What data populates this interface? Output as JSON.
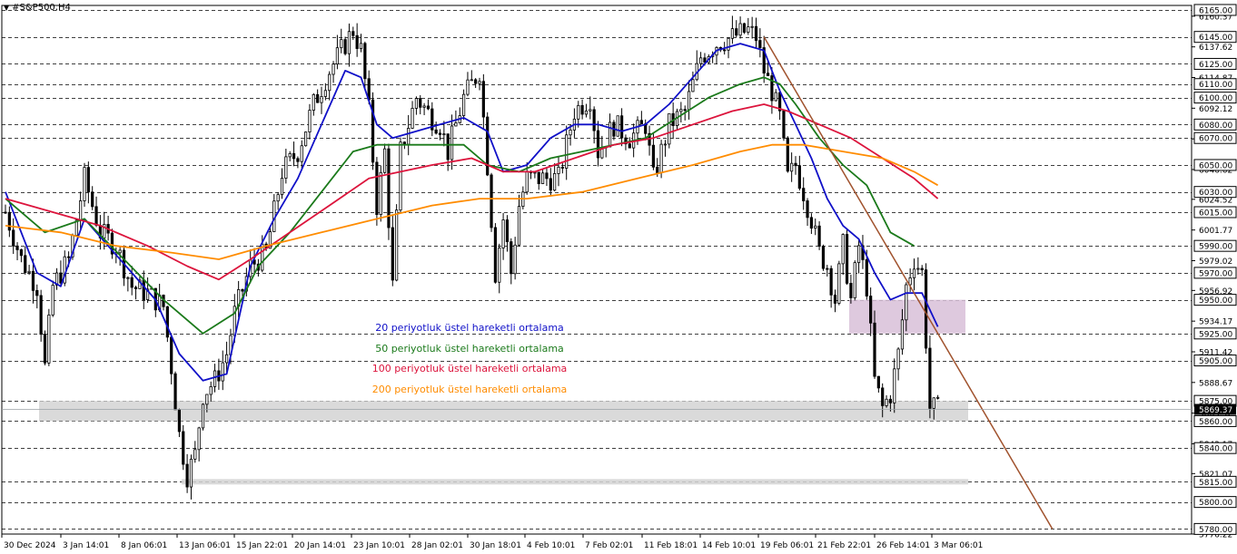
{
  "window": {
    "title": "#S&P500,H4",
    "menu_icon": "triangle-down-icon"
  },
  "chart_data": {
    "type": "candlestick",
    "symbol": "#S&P500",
    "timeframe": "H4",
    "ylim": [
      5776.22,
      6167
    ],
    "grid": "horizontal dashed at key levels",
    "x_ticks": [
      "30 Dec 2024",
      "3 Jan 14:01",
      "8 Jan 06:01",
      "13 Jan 06:01",
      "15 Jan 22:01",
      "20 Jan 14:01",
      "23 Jan 10:01",
      "28 Jan 02:01",
      "30 Jan 18:01",
      "4 Feb 10:01",
      "7 Feb 02:01",
      "11 Feb 18:01",
      "14 Feb 10:01",
      "19 Feb 06:01",
      "21 Feb 22:01",
      "26 Feb 14:01",
      "3 Mar 06:01"
    ],
    "y_ticks": [
      6160.37,
      6137.62,
      6114.87,
      6092.12,
      6069.37,
      6046.62,
      6024.52,
      6001.77,
      5979.02,
      5956.92,
      5934.17,
      5911.42,
      5888.67,
      5865.92,
      5843.17,
      5821.07,
      5776.22
    ],
    "boxed_levels": [
      6165.0,
      6145.0,
      6125.0,
      6110.0,
      6100.0,
      6080.0,
      6070.0,
      6050.0,
      6030.0,
      6015.0,
      5990.0,
      5970.0,
      5950.0,
      5925.0,
      5905.0,
      5875.0,
      5860.0,
      5840.0,
      5815.0,
      5800.0,
      5780.0
    ],
    "current_price": 5869.37,
    "zones": [
      {
        "name": "support-zone",
        "y1": 5860,
        "y2": 5875,
        "color": "#d3d3d3"
      },
      {
        "name": "support-line-zone",
        "y1": 5813,
        "y2": 5817,
        "color": "#d3d3d3"
      },
      {
        "name": "resistance-zone",
        "y1": 5925,
        "y2": 5950,
        "color": "#d8bfd8"
      }
    ],
    "trendline": {
      "color": "#a0522d",
      "from": {
        "bar": 192,
        "y": 6145
      },
      "to": {
        "bar": 265,
        "y": 5780
      }
    },
    "legend": [
      {
        "label": "20 periyotluk üstel hareketli ortalama",
        "color": "#1010c8"
      },
      {
        "label": "50 periyotluk üstel hareketli ortalama",
        "color": "#1b7a1b"
      },
      {
        "label": "100 periyotluk üstel hareketli ortalama",
        "color": "#dc143c"
      },
      {
        "label": "200 periyotluk üstel hareketli ortalama",
        "color": "#ff8c00"
      }
    ],
    "close_path": [
      [
        0,
        6015
      ],
      [
        4,
        5980
      ],
      [
        8,
        5960
      ],
      [
        10,
        5900
      ],
      [
        12,
        5960
      ],
      [
        16,
        5980
      ],
      [
        20,
        6040
      ],
      [
        24,
        6000
      ],
      [
        28,
        5990
      ],
      [
        32,
        5960
      ],
      [
        36,
        5955
      ],
      [
        40,
        5945
      ],
      [
        42,
        5900
      ],
      [
        44,
        5850
      ],
      [
        46,
        5820
      ],
      [
        48,
        5835
      ],
      [
        50,
        5880
      ],
      [
        53,
        5890
      ],
      [
        56,
        5910
      ],
      [
        58,
        5940
      ],
      [
        62,
        5975
      ],
      [
        66,
        5985
      ],
      [
        70,
        6045
      ],
      [
        74,
        6060
      ],
      [
        78,
        6095
      ],
      [
        82,
        6120
      ],
      [
        86,
        6140
      ],
      [
        88,
        6150
      ],
      [
        90,
        6135
      ],
      [
        92,
        6090
      ],
      [
        94,
        6020
      ],
      [
        96,
        6060
      ],
      [
        98,
        5960
      ],
      [
        100,
        6060
      ],
      [
        104,
        6100
      ],
      [
        108,
        6085
      ],
      [
        110,
        6080
      ],
      [
        112,
        6060
      ],
      [
        116,
        6100
      ],
      [
        120,
        6120
      ],
      [
        122,
        6050
      ],
      [
        124,
        5970
      ],
      [
        126,
        6010
      ],
      [
        128,
        5970
      ],
      [
        130,
        6020
      ],
      [
        132,
        6040
      ],
      [
        136,
        6040
      ],
      [
        140,
        6040
      ],
      [
        144,
        6090
      ],
      [
        148,
        6100
      ],
      [
        150,
        6060
      ],
      [
        154,
        6080
      ],
      [
        158,
        6070
      ],
      [
        162,
        6080
      ],
      [
        164,
        6040
      ],
      [
        168,
        6080
      ],
      [
        172,
        6090
      ],
      [
        176,
        6130
      ],
      [
        180,
        6140
      ],
      [
        184,
        6145
      ],
      [
        188,
        6150
      ],
      [
        190,
        6145
      ],
      [
        192,
        6120
      ],
      [
        194,
        6105
      ],
      [
        196,
        6085
      ],
      [
        198,
        6040
      ],
      [
        200,
        6050
      ],
      [
        202,
        6030
      ],
      [
        204,
        6010
      ],
      [
        206,
        5985
      ],
      [
        208,
        5975
      ],
      [
        210,
        5950
      ],
      [
        212,
        5990
      ],
      [
        214,
        5950
      ],
      [
        216,
        5990
      ],
      [
        218,
        5960
      ],
      [
        220,
        5890
      ],
      [
        222,
        5870
      ],
      [
        224,
        5880
      ],
      [
        226,
        5910
      ],
      [
        228,
        5960
      ],
      [
        230,
        5980
      ],
      [
        232,
        5970
      ],
      [
        234,
        5870
      ],
      [
        236,
        5869
      ]
    ],
    "ema_series": {
      "ema20": [
        [
          0,
          6030
        ],
        [
          8,
          5970
        ],
        [
          14,
          5960
        ],
        [
          20,
          6010
        ],
        [
          26,
          5990
        ],
        [
          32,
          5970
        ],
        [
          38,
          5950
        ],
        [
          44,
          5910
        ],
        [
          50,
          5890
        ],
        [
          56,
          5895
        ],
        [
          62,
          5975
        ],
        [
          68,
          6010
        ],
        [
          74,
          6040
        ],
        [
          80,
          6080
        ],
        [
          86,
          6120
        ],
        [
          90,
          6115
        ],
        [
          94,
          6080
        ],
        [
          98,
          6070
        ],
        [
          104,
          6075
        ],
        [
          110,
          6080
        ],
        [
          116,
          6085
        ],
        [
          122,
          6075
        ],
        [
          126,
          6045
        ],
        [
          132,
          6050
        ],
        [
          138,
          6070
        ],
        [
          144,
          6080
        ],
        [
          150,
          6080
        ],
        [
          156,
          6075
        ],
        [
          162,
          6080
        ],
        [
          168,
          6095
        ],
        [
          174,
          6115
        ],
        [
          180,
          6135
        ],
        [
          186,
          6140
        ],
        [
          192,
          6135
        ],
        [
          196,
          6105
        ],
        [
          200,
          6080
        ],
        [
          204,
          6055
        ],
        [
          208,
          6025
        ],
        [
          212,
          6005
        ],
        [
          216,
          5995
        ],
        [
          220,
          5970
        ],
        [
          224,
          5950
        ],
        [
          228,
          5955
        ],
        [
          232,
          5955
        ],
        [
          236,
          5930
        ]
      ],
      "ema50": [
        [
          0,
          6025
        ],
        [
          10,
          6000
        ],
        [
          20,
          6010
        ],
        [
          30,
          5980
        ],
        [
          40,
          5950
        ],
        [
          50,
          5925
        ],
        [
          58,
          5940
        ],
        [
          64,
          5975
        ],
        [
          72,
          6000
        ],
        [
          80,
          6030
        ],
        [
          88,
          6060
        ],
        [
          94,
          6065
        ],
        [
          100,
          6065
        ],
        [
          108,
          6065
        ],
        [
          116,
          6065
        ],
        [
          122,
          6050
        ],
        [
          130,
          6045
        ],
        [
          138,
          6055
        ],
        [
          146,
          6060
        ],
        [
          154,
          6065
        ],
        [
          162,
          6070
        ],
        [
          170,
          6085
        ],
        [
          178,
          6100
        ],
        [
          186,
          6110
        ],
        [
          192,
          6115
        ],
        [
          196,
          6110
        ],
        [
          200,
          6095
        ],
        [
          206,
          6070
        ],
        [
          212,
          6050
        ],
        [
          218,
          6035
        ],
        [
          224,
          6000
        ],
        [
          230,
          5990
        ]
      ],
      "ema100": [
        [
          0,
          6025
        ],
        [
          12,
          6015
        ],
        [
          24,
          6005
        ],
        [
          36,
          5990
        ],
        [
          46,
          5975
        ],
        [
          54,
          5965
        ],
        [
          62,
          5980
        ],
        [
          72,
          6000
        ],
        [
          82,
          6020
        ],
        [
          92,
          6040
        ],
        [
          100,
          6045
        ],
        [
          108,
          6050
        ],
        [
          118,
          6055
        ],
        [
          126,
          6045
        ],
        [
          134,
          6045
        ],
        [
          144,
          6055
        ],
        [
          154,
          6065
        ],
        [
          164,
          6070
        ],
        [
          174,
          6080
        ],
        [
          184,
          6090
        ],
        [
          192,
          6095
        ],
        [
          198,
          6090
        ],
        [
          206,
          6080
        ],
        [
          214,
          6070
        ],
        [
          222,
          6055
        ],
        [
          230,
          6040
        ],
        [
          236,
          6025
        ]
      ],
      "ema200": [
        [
          0,
          6005
        ],
        [
          14,
          6000
        ],
        [
          28,
          5990
        ],
        [
          42,
          5985
        ],
        [
          54,
          5980
        ],
        [
          66,
          5990
        ],
        [
          80,
          6000
        ],
        [
          94,
          6010
        ],
        [
          108,
          6020
        ],
        [
          120,
          6025
        ],
        [
          132,
          6025
        ],
        [
          146,
          6030
        ],
        [
          160,
          6040
        ],
        [
          174,
          6050
        ],
        [
          186,
          6060
        ],
        [
          194,
          6065
        ],
        [
          202,
          6065
        ],
        [
          212,
          6060
        ],
        [
          222,
          6055
        ],
        [
          230,
          6045
        ],
        [
          236,
          6035
        ]
      ]
    }
  }
}
